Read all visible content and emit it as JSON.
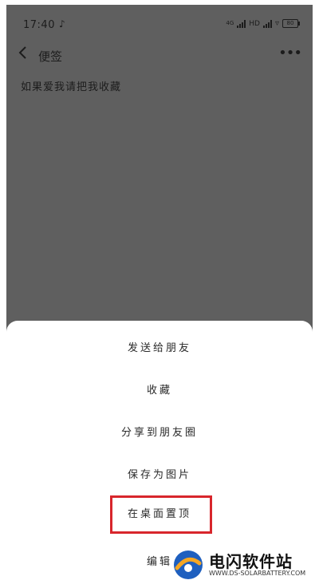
{
  "status_bar": {
    "time": "17:40",
    "notification_icon": "♪",
    "network_small": "4G",
    "network_label": "HD",
    "battery_label": "80"
  },
  "header": {
    "title": "便签"
  },
  "note": {
    "content": "如果爱我请把我收藏"
  },
  "sheet": {
    "items": [
      {
        "label": "发送给朋友"
      },
      {
        "label": "收藏"
      },
      {
        "label": "分享到朋友圈"
      },
      {
        "label": "保存为图片"
      },
      {
        "label": "在桌面置顶"
      },
      {
        "label": "编辑"
      }
    ],
    "highlighted_index": 4,
    "highlight_color": "#d8262c"
  },
  "watermark": {
    "name": "电闪软件站",
    "url": "WWW.DS-SOLARBATTERY.COM"
  }
}
